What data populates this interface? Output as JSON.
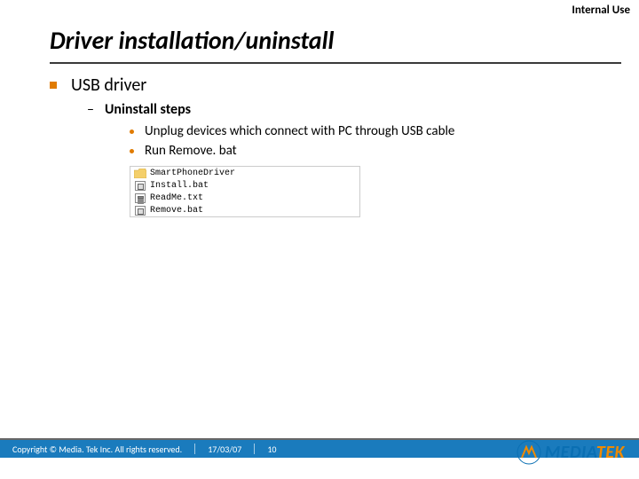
{
  "classification": "Internal Use",
  "title": "Driver installation/uninstall",
  "content": {
    "lvl1": "USB driver",
    "lvl2": "Uninstall steps",
    "lvl3a": "Unplug devices which connect with PC through USB cable",
    "lvl3b": "Run Remove. bat"
  },
  "files": {
    "folder": "SmartPhoneDriver",
    "f1": "Install.bat",
    "f2": "ReadMe.txt",
    "f3": "Remove.bat"
  },
  "footer": {
    "copyright": "Copyright © Media. Tek Inc. All rights reserved.",
    "date": "17/03/07",
    "page": "10"
  },
  "logo": {
    "part1": "MEDIA",
    "part2": "TEK"
  }
}
